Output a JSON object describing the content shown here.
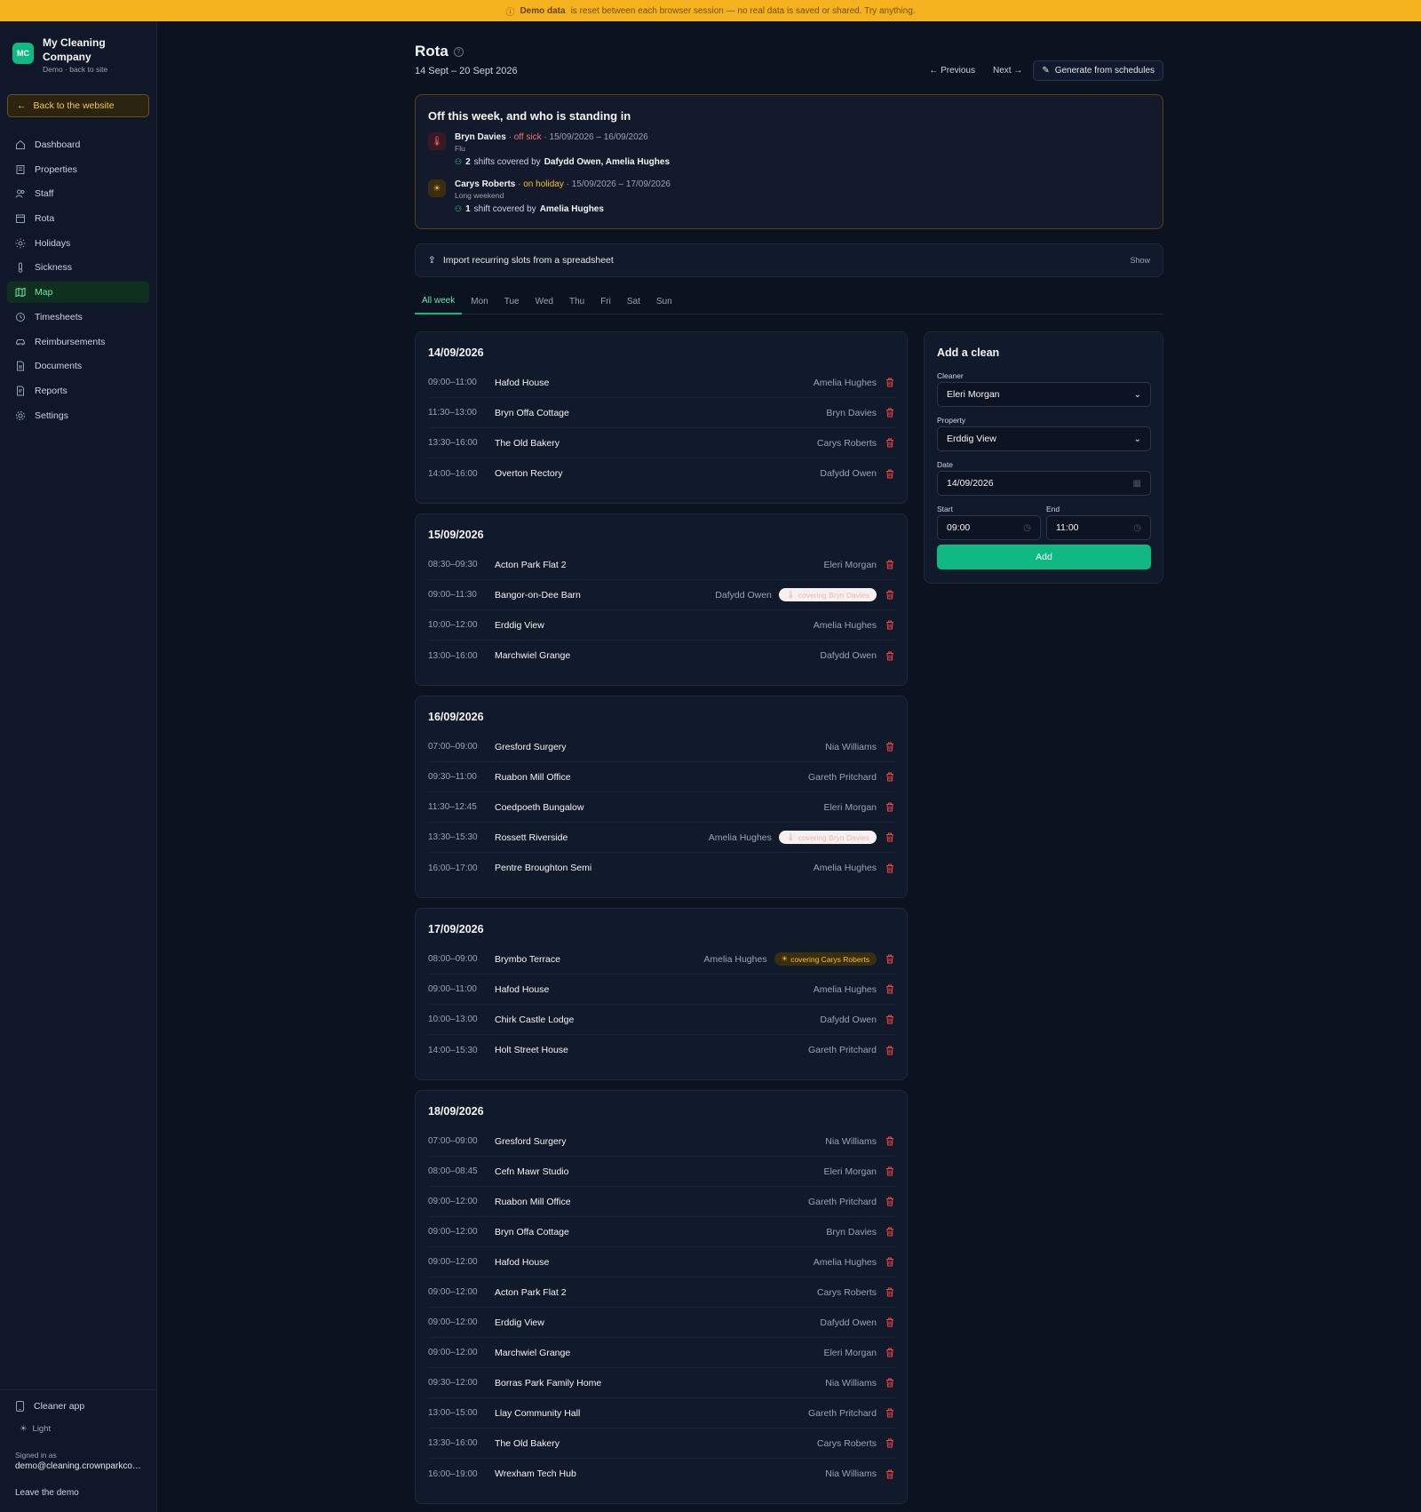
{
  "banner": {
    "bold": "Demo data",
    "text": "is reset between each browser session — no real data is saved or shared. Try anything."
  },
  "brand": {
    "logo": "MC",
    "name": "My Cleaning Company",
    "sub": "Demo · back to site"
  },
  "sidebar": {
    "back_label": "Back to the website",
    "items": [
      {
        "label": "Dashboard",
        "icon": "home-icon"
      },
      {
        "label": "Properties",
        "icon": "building-icon"
      },
      {
        "label": "Staff",
        "icon": "users-icon"
      },
      {
        "label": "Rota",
        "icon": "calendar-icon"
      },
      {
        "label": "Holidays",
        "icon": "sun-icon"
      },
      {
        "label": "Sickness",
        "icon": "thermometer-icon"
      },
      {
        "label": "Map",
        "icon": "map-icon"
      },
      {
        "label": "Timesheets",
        "icon": "clock-icon"
      },
      {
        "label": "Reimbursements",
        "icon": "car-icon"
      },
      {
        "label": "Documents",
        "icon": "document-icon"
      },
      {
        "label": "Reports",
        "icon": "report-icon"
      },
      {
        "label": "Settings",
        "icon": "gear-icon"
      }
    ],
    "active_item": "Map",
    "cleaner_app": "Cleaner app",
    "theme": "Light",
    "signed_in_label": "Signed in as",
    "email": "demo@cleaning.crownparkconsulting.co.uk",
    "leave": "Leave the demo"
  },
  "page": {
    "title": "Rota",
    "date_range": "14 Sept – 20 Sept 2026",
    "prev": "← Previous",
    "next": "Next →",
    "generate": "Generate from schedules"
  },
  "off_week": {
    "title": "Off this week, and who is standing in",
    "entries": [
      {
        "name": "Bryn Davies",
        "status": "off sick",
        "sep": " · ",
        "dates": "15/09/2026 – 16/09/2026",
        "reason": "Flu",
        "count": "2",
        "covered_text": "shifts covered by",
        "covered_by": "Dafydd Owen, Amelia Hughes"
      },
      {
        "name": "Carys Roberts",
        "status": "on holiday",
        "sep": " · ",
        "dates": "15/09/2026 – 17/09/2026",
        "reason": "Long weekend",
        "count": "1",
        "covered_text": "shift covered by",
        "covered_by": "Amelia Hughes"
      }
    ]
  },
  "import": {
    "label": "Import recurring slots from a spreadsheet",
    "toggle": "Show"
  },
  "tabs": [
    "All week",
    "Mon",
    "Tue",
    "Wed",
    "Thu",
    "Fri",
    "Sat",
    "Sun"
  ],
  "active_tab": "All week",
  "days": [
    {
      "date": "14/09/2026",
      "slots": [
        {
          "time": "09:00–11:00",
          "property": "Hafod House",
          "cleaner": "Amelia Hughes"
        },
        {
          "time": "11:30–13:00",
          "property": "Bryn Offa Cottage",
          "cleaner": "Bryn Davies"
        },
        {
          "time": "13:30–16:00",
          "property": "The Old Bakery",
          "cleaner": "Carys Roberts"
        },
        {
          "time": "14:00–16:00",
          "property": "Overton Rectory",
          "cleaner": "Dafydd Owen"
        }
      ]
    },
    {
      "date": "15/09/2026",
      "slots": [
        {
          "time": "08:30–09:30",
          "property": "Acton Park Flat 2",
          "cleaner": "Eleri Morgan"
        },
        {
          "time": "09:00–11:30",
          "property": "Bangor-on-Dee Barn",
          "cleaner": "Dafydd Owen",
          "cover": "covering Bryn Davies",
          "cover_type": "sick"
        },
        {
          "time": "10:00–12:00",
          "property": "Erddig View",
          "cleaner": "Amelia Hughes"
        },
        {
          "time": "13:00–16:00",
          "property": "Marchwiel Grange",
          "cleaner": "Dafydd Owen"
        }
      ]
    },
    {
      "date": "16/09/2026",
      "slots": [
        {
          "time": "07:00–09:00",
          "property": "Gresford Surgery",
          "cleaner": "Nia Williams"
        },
        {
          "time": "09:30–11:00",
          "property": "Ruabon Mill Office",
          "cleaner": "Gareth Pritchard"
        },
        {
          "time": "11:30–12:45",
          "property": "Coedpoeth Bungalow",
          "cleaner": "Eleri Morgan"
        },
        {
          "time": "13:30–15:30",
          "property": "Rossett Riverside",
          "cleaner": "Amelia Hughes",
          "cover": "covering Bryn Davies",
          "cover_type": "sick"
        },
        {
          "time": "16:00–17:00",
          "property": "Pentre Broughton Semi",
          "cleaner": "Amelia Hughes"
        }
      ]
    },
    {
      "date": "17/09/2026",
      "slots": [
        {
          "time": "08:00–09:00",
          "property": "Brymbo Terrace",
          "cleaner": "Amelia Hughes",
          "cover": "covering Carys Roberts",
          "cover_type": "holiday"
        },
        {
          "time": "09:00–11:00",
          "property": "Hafod House",
          "cleaner": "Amelia Hughes"
        },
        {
          "time": "10:00–13:00",
          "property": "Chirk Castle Lodge",
          "cleaner": "Dafydd Owen"
        },
        {
          "time": "14:00–15:30",
          "property": "Holt Street House",
          "cleaner": "Gareth Pritchard"
        }
      ]
    },
    {
      "date": "18/09/2026",
      "slots": [
        {
          "time": "07:00–09:00",
          "property": "Gresford Surgery",
          "cleaner": "Nia Williams"
        },
        {
          "time": "08:00–08:45",
          "property": "Cefn Mawr Studio",
          "cleaner": "Eleri Morgan"
        },
        {
          "time": "09:00–12:00",
          "property": "Ruabon Mill Office",
          "cleaner": "Gareth Pritchard"
        },
        {
          "time": "09:00–12:00",
          "property": "Bryn Offa Cottage",
          "cleaner": "Bryn Davies"
        },
        {
          "time": "09:00–12:00",
          "property": "Hafod House",
          "cleaner": "Amelia Hughes"
        },
        {
          "time": "09:00–12:00",
          "property": "Acton Park Flat 2",
          "cleaner": "Carys Roberts"
        },
        {
          "time": "09:00–12:00",
          "property": "Erddig View",
          "cleaner": "Dafydd Owen"
        },
        {
          "time": "09:00–12:00",
          "property": "Marchwiel Grange",
          "cleaner": "Eleri Morgan"
        },
        {
          "time": "09:30–12:00",
          "property": "Borras Park Family Home",
          "cleaner": "Nia Williams"
        },
        {
          "time": "13:00–15:00",
          "property": "Llay Community Hall",
          "cleaner": "Gareth Pritchard"
        },
        {
          "time": "13:30–16:00",
          "property": "The Old Bakery",
          "cleaner": "Carys Roberts"
        },
        {
          "time": "16:00–19:00",
          "property": "Wrexham Tech Hub",
          "cleaner": "Nia Williams"
        }
      ]
    }
  ],
  "add_clean": {
    "title": "Add a clean",
    "cleaner_label": "Cleaner",
    "cleaner_value": "Eleri Morgan",
    "property_label": "Property",
    "property_value": "Erddig View",
    "date_label": "Date",
    "date_value": "14/09/2026",
    "start_label": "Start",
    "start_value": "09:00",
    "end_label": "End",
    "end_value": "11:00",
    "button": "Add"
  },
  "colors": {
    "accent": "#10b981",
    "banner": "#f5b21f",
    "danger": "#ef4444",
    "warning": "#fbbf24"
  }
}
